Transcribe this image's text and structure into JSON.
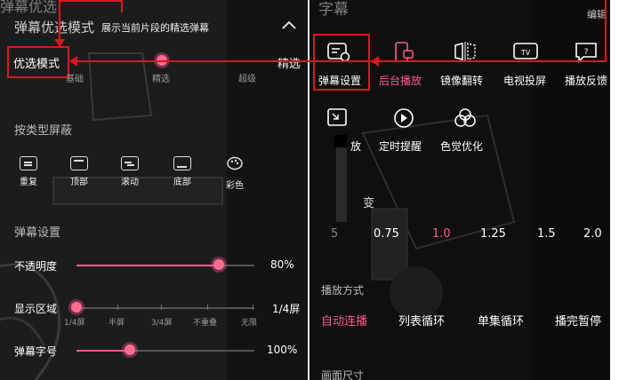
{
  "left_panel": {
    "top_strip": "弹幕优选",
    "title": "弹幕优选模式",
    "subtitle": "展示当前片段的精选弹幕",
    "mode_label": "优选模式",
    "mode_value": "精选",
    "mode_levels": [
      "基础",
      "精选",
      "超级"
    ],
    "block_title": "按类型屏蔽",
    "block_types": [
      {
        "label": "重复",
        "icon": "repeat-icon"
      },
      {
        "label": "顶部",
        "icon": "top-icon"
      },
      {
        "label": "滚动",
        "icon": "scroll-icon"
      },
      {
        "label": "底部",
        "icon": "bottom-icon"
      },
      {
        "label": "彩色",
        "icon": "palette-icon"
      }
    ],
    "settings_title": "弹幕设置",
    "opacity_label": "不透明度",
    "opacity_value": "80%",
    "opacity_level": 0.8,
    "area_label": "显示区域",
    "area_value": "1/4屏",
    "area_ticks": [
      "1/4屏",
      "半屏",
      "3/4屏",
      "不重叠",
      "无限"
    ],
    "fontsize_label": "弹幕字号",
    "fontsize_value": "100%",
    "fontsize_level": 0.3
  },
  "right_panel": {
    "top_text": "字幕",
    "edit_label": "编辑",
    "row1": [
      {
        "label": "弹幕设置",
        "icon": "danmaku-settings-icon"
      },
      {
        "label": "后台播放",
        "icon": "background-play-icon"
      },
      {
        "label": "镜像翻转",
        "icon": "mirror-flip-icon"
      },
      {
        "label": "电视投屏",
        "icon": "tv-cast-icon"
      },
      {
        "label": "播放反馈",
        "icon": "feedback-icon"
      }
    ],
    "row2": [
      {
        "label": "放",
        "icon": "pip-icon"
      },
      {
        "label": "定时提醒",
        "icon": "timer-icon"
      },
      {
        "label": "色觉优化",
        "icon": "color-vision-icon"
      }
    ],
    "speed_label": "变",
    "speeds": [
      "5",
      "0.75",
      "1.0",
      "1.25",
      "1.5",
      "2.0"
    ],
    "speed_selected": "1.0",
    "play_mode_title": "播放方式",
    "play_modes": [
      "自动连播",
      "列表循环",
      "单集循环",
      "播完暂停"
    ],
    "play_mode_selected": "自动连播",
    "screen_size_title": "画面尺寸"
  },
  "colors": {
    "accent": "#ff5a8c",
    "annotation": "#e0151f"
  }
}
